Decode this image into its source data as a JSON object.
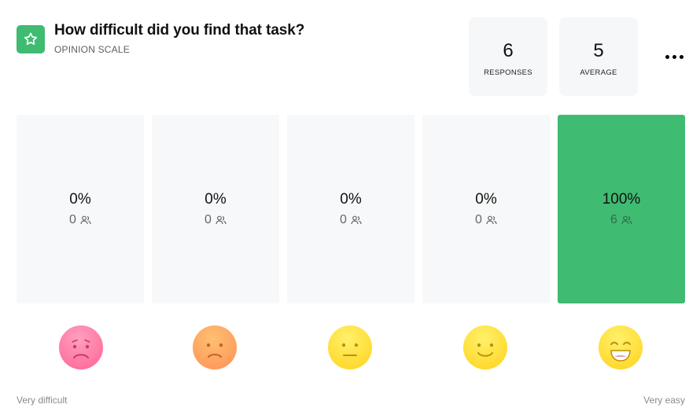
{
  "question": {
    "title": "How difficult did you find that task?",
    "type_label": "OPINION SCALE",
    "icon": "star-icon",
    "accent_color": "#3fbb72"
  },
  "stats": {
    "responses": {
      "value": "6",
      "label": "RESPONSES"
    },
    "average": {
      "value": "5",
      "label": "AVERAGE"
    }
  },
  "menu": {
    "icon": "more-horizontal-icon"
  },
  "scale": {
    "left_label": "Very difficult",
    "right_label": "Very easy",
    "options": [
      {
        "percent": "0%",
        "count": "0",
        "percent_value": 0,
        "face": "very-sad-face-icon",
        "face_color": "#ff7ca3"
      },
      {
        "percent": "0%",
        "count": "0",
        "percent_value": 0,
        "face": "sad-face-icon",
        "face_color": "#ffa561"
      },
      {
        "percent": "0%",
        "count": "0",
        "percent_value": 0,
        "face": "neutral-face-icon",
        "face_color": "#ffe13b"
      },
      {
        "percent": "0%",
        "count": "0",
        "percent_value": 0,
        "face": "smiling-face-icon",
        "face_color": "#ffe13b"
      },
      {
        "percent": "100%",
        "count": "6",
        "percent_value": 100,
        "face": "grinning-face-icon",
        "face_color": "#ffe13b"
      }
    ]
  }
}
